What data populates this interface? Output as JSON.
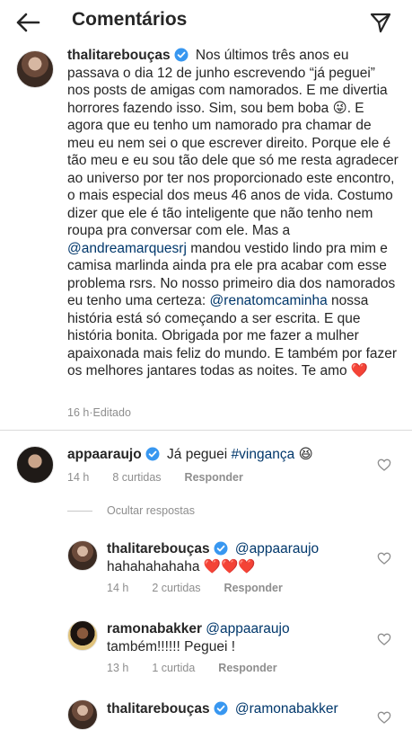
{
  "header": {
    "title": "Comentários"
  },
  "caption": {
    "username": "thalitarebouças",
    "t1": "Nos últimos três anos eu passava o dia 12 de junho escrevendo “já peguei” nos posts de amigas com namorados. E me divertia horrores fazendo isso. Sim, sou bem boba ",
    "e1": "😜",
    "t2": ". E agora que eu tenho um namorado pra chamar de meu eu nem sei o que escrever direito. Porque ele é tão meu e eu sou tão dele que só me resta agradecer ao universo por ter nos proporcionado este encontro, o mais especial dos meus 46 anos de vida. Costumo dizer que ele é tão inteligente que não tenho nem roupa pra conversar com ele. Mas a ",
    "m1": "@andreamarquesrj",
    "t3": " mandou vestido lindo pra mim e camisa marlinda ainda pra ele pra acabar com esse problema rsrs. No nosso primeiro dia dos namorados eu tenho uma certeza: ",
    "m2": "@renatomcaminha",
    "t4": " nossa história está só começando a ser escrita. E que história bonita. Obrigada por me fazer a mulher apaixonada mais feliz do mundo. E também por fazer os melhores jantares todas as noites. Te amo ",
    "e2": "❤️",
    "time": "16 h",
    "sep": " · ",
    "edited": "Editado"
  },
  "comment1": {
    "username": "appaaraujo",
    "text": "Já peguei ",
    "hashtag": "#vingança",
    "emoji": "😆",
    "time": "14 h",
    "likes": "8 curtidas",
    "reply": "Responder"
  },
  "hide_replies": "Ocultar respostas",
  "reply1": {
    "username": "thalitarebouças",
    "mention": "@appaaraujo",
    "text": "hahahahahaha ",
    "emoji": "❤️❤️❤️",
    "time": "14 h",
    "likes": "2 curtidas",
    "reply": "Responder"
  },
  "reply2": {
    "username": "ramonabakker",
    "mention": "@appaaraujo",
    "text": "também!!!!!! Peguei !",
    "time": "13 h",
    "likes": "1 curtida",
    "reply": "Responder"
  },
  "reply3": {
    "username": "thalitarebouças",
    "mention": "@ramonabakker"
  },
  "colors": {
    "text": "#262626",
    "secondary": "#8e8e8e",
    "link": "#00376b",
    "verified": "#3897f0",
    "divider": "#dbdbdb"
  },
  "icons": {
    "back": "arrow-left-icon",
    "send": "paper-plane-icon",
    "like": "heart-outline-icon",
    "verified": "verified-badge-icon"
  }
}
